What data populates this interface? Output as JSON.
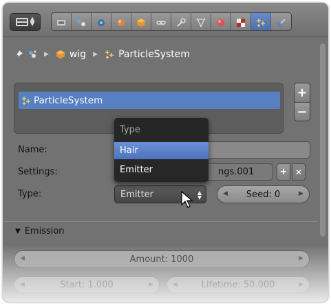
{
  "toolbar": {
    "context_icons": [
      "render-icon",
      "render-layers-icon",
      "scene-icon",
      "world-icon",
      "object-icon",
      "constraints-icon",
      "modifiers-icon",
      "object-data-icon",
      "material-icon",
      "texture-icon",
      "particles-icon",
      "physics-icon"
    ],
    "active_context": "particles-icon"
  },
  "breadcrumb": {
    "object": "wig",
    "particle_system": "ParticleSystem"
  },
  "particle_list": {
    "items": [
      "ParticleSystem"
    ]
  },
  "labels": {
    "name": "Name:",
    "settings": "Settings:",
    "type": "Type:"
  },
  "settings": {
    "value": "ngs.001"
  },
  "type_select": {
    "value": "Emitter"
  },
  "seed": {
    "label": "Seed: 0"
  },
  "menu": {
    "title": "Type",
    "items": [
      "Hair",
      "Emitter"
    ],
    "highlighted": "Hair"
  },
  "emission": {
    "header": "Emission",
    "amount": "Amount: 1000",
    "start": "Start: 1.000",
    "lifetime": "Lifetime: 50.000"
  },
  "colors": {
    "accent": "#5680c2",
    "panel": "#727272",
    "menu_bg": "#232323"
  }
}
